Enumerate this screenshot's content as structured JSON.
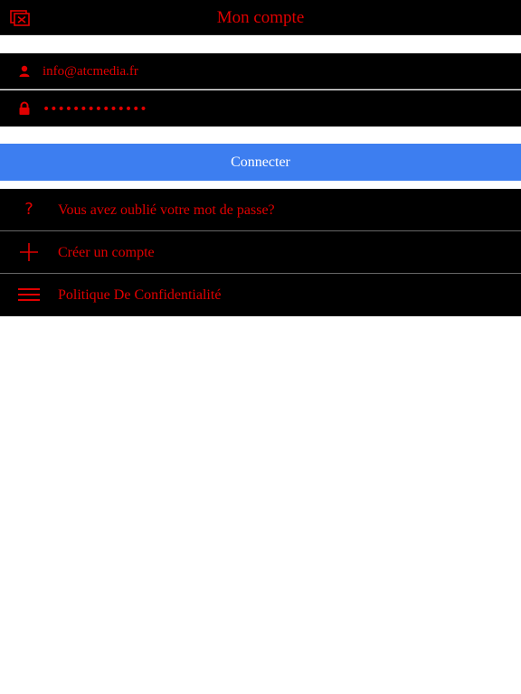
{
  "header": {
    "title": "Mon compte",
    "close_icon": "close-window-icon"
  },
  "login": {
    "email_value": "info@atcmedia.fr",
    "password_value": "••••••••••••••",
    "user_icon": "user-icon",
    "lock_icon": "lock-icon",
    "connect_label": "Connecter"
  },
  "menu": {
    "items": [
      {
        "label": "Vous avez oublié votre mot de passe?",
        "icon": "question-icon"
      },
      {
        "label": "Créer un compte",
        "icon": "plus-icon"
      },
      {
        "label": "Politique De Confidentialité",
        "icon": "hamburger-menu-icon"
      }
    ]
  },
  "colors": {
    "accent": "#e00000",
    "button": "#3d7ef0",
    "bar": "#000000",
    "background": "#ffffff"
  }
}
